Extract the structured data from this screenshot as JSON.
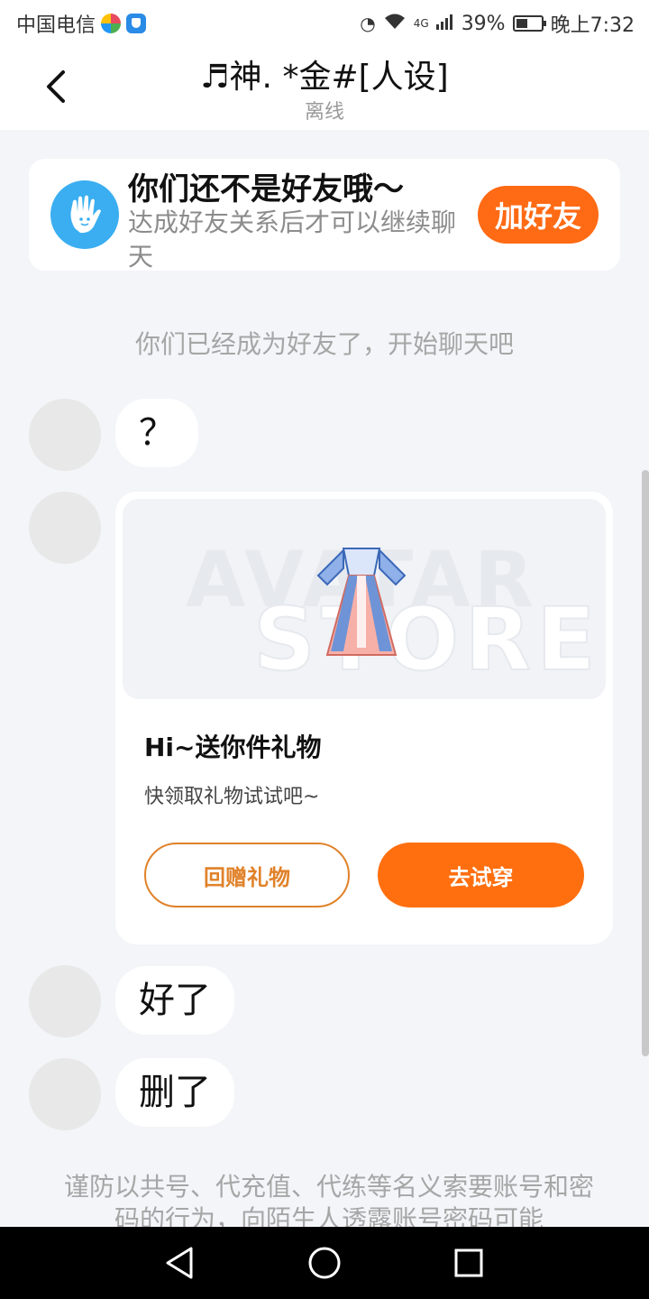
{
  "status_bar": {
    "carrier": "中国电信",
    "network": "4G",
    "battery": "39%",
    "time": "晚上7:32"
  },
  "header": {
    "title": "♬神. *金#[人设]",
    "subtitle": "离线"
  },
  "friend_banner": {
    "title": "你们还不是好友哦～",
    "description": "达成好友关系后才可以继续聊天",
    "button": "加好友"
  },
  "system_message": "你们已经成为好友了，开始聊天吧",
  "messages": [
    {
      "text": "？"
    },
    {
      "text": "好了"
    },
    {
      "text": "删了"
    }
  ],
  "gift_card": {
    "watermark_top": "AVATAR",
    "watermark_bottom": "STORE",
    "title": "Hi~送你件礼物",
    "description": "快领取礼物试试吧~",
    "return_button": "回赠礼物",
    "try_button": "去试穿"
  },
  "warning": "谨防以共号、代充值、代练等名义索要账号和密码的行为，向陌生人透露账号密码可能",
  "colors": {
    "accent": "#ff6a14",
    "hand_icon": "#3aaef0"
  }
}
